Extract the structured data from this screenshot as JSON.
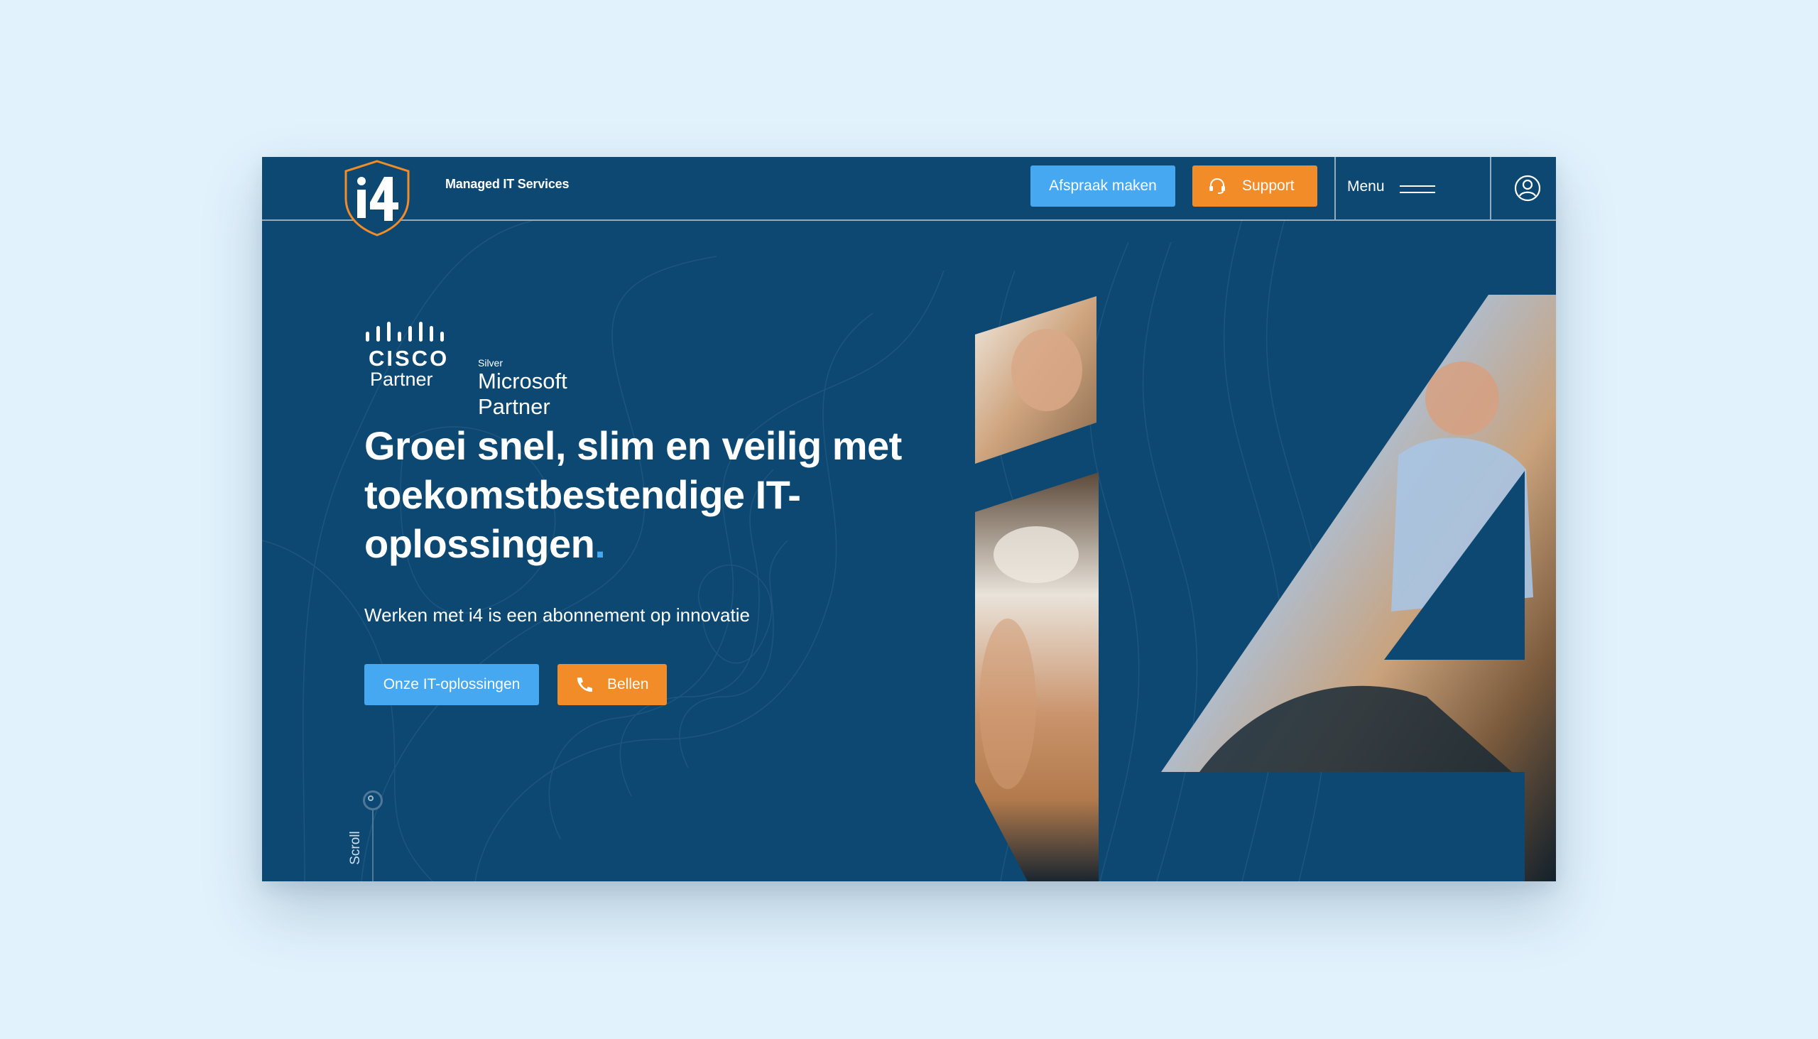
{
  "header": {
    "tagline": "Managed IT Services",
    "afspraak_label": "Afspraak maken",
    "support_label": "Support",
    "menu_label": "Menu"
  },
  "hero": {
    "partners": {
      "cisco_word": "CISCO",
      "cisco_partner": "Partner",
      "ms_tier": "Silver",
      "ms_name": "Microsoft Partner"
    },
    "headline_main": "Groei snel, slim en veilig met toekomstbestendige IT-oplossingen",
    "headline_dot": ".",
    "subline": "Werken met i4 is een abonnement op innovatie",
    "cta_primary": "Onze IT-oplossingen",
    "cta_secondary": "Bellen",
    "scroll_label": "Scroll"
  },
  "colors": {
    "background": "#e1f2fd",
    "navy": "#0c4872",
    "accent_blue": "#45a8f0",
    "accent_orange": "#f28c28"
  },
  "icons": {
    "support": "headset-icon",
    "call": "phone-icon",
    "menu": "hamburger-icon",
    "account": "user-circle-icon"
  }
}
